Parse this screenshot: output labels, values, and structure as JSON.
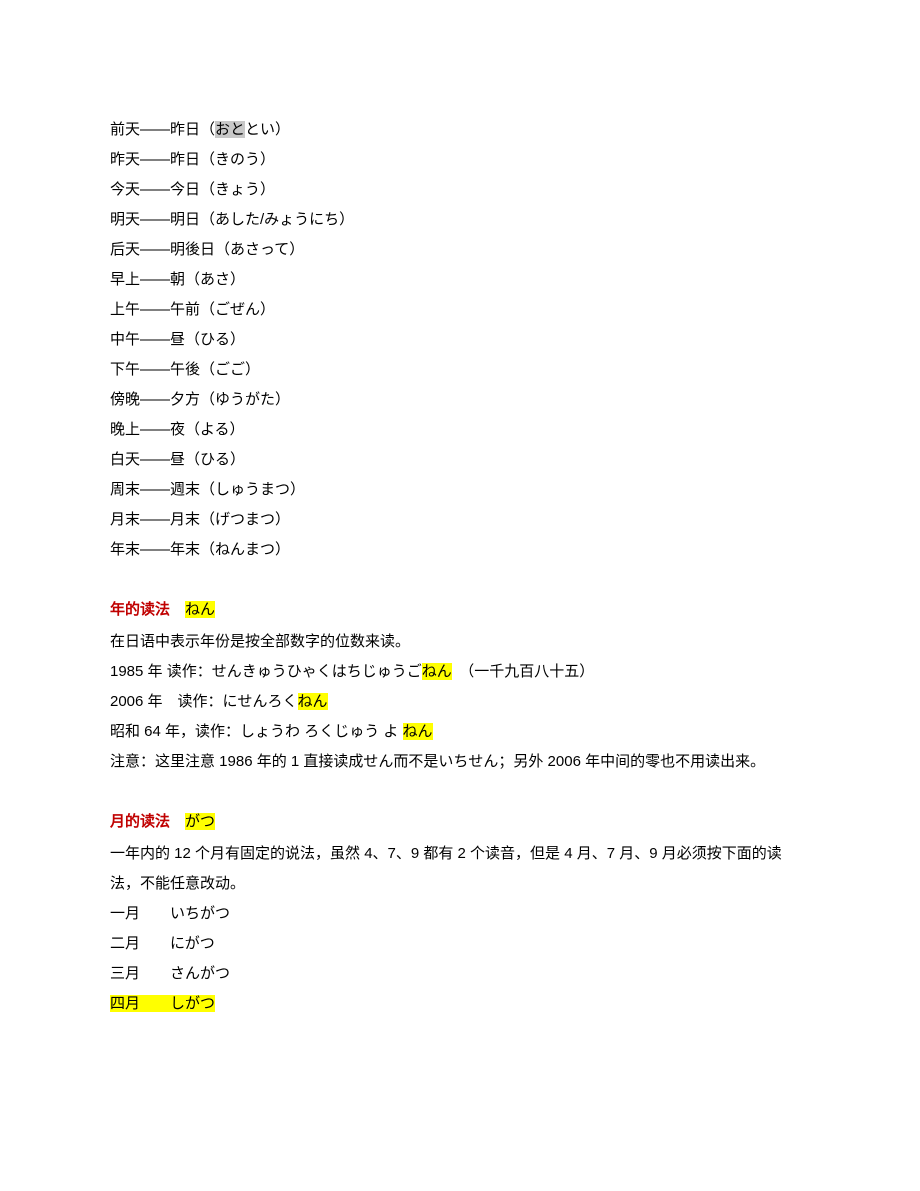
{
  "vocab": [
    {
      "pre": "前天——昨日（",
      "gray": "おと",
      "post": "とい）"
    },
    {
      "text": "昨天——昨日（きのう）"
    },
    {
      "text": "今天——今日（きょう）"
    },
    {
      "text": "明天——明日（あした/みょうにち）"
    },
    {
      "text": "后天——明後日（あさって）"
    },
    {
      "text": "早上——朝（あさ）"
    },
    {
      "text": "上午——午前（ごぜん）"
    },
    {
      "text": "中午——昼（ひる）"
    },
    {
      "text": "下午——午後（ごご）"
    },
    {
      "text": "傍晚——夕方（ゆうがた）"
    },
    {
      "text": "晚上——夜（よる）"
    },
    {
      "text": "白天——昼（ひる）"
    },
    {
      "text": "周末——週末（しゅうまつ）"
    },
    {
      "text": "月末——月末（げつまつ）"
    },
    {
      "text": "年末——年末（ねんまつ）"
    }
  ],
  "year": {
    "title": "年的读法",
    "tag": "ねん",
    "intro": "在日语中表示年份是按全部数字的位数来读。",
    "ex1_pre": "1985 年 读作：せんきゅうひゃくはちじゅうご",
    "ex1_hl": "ねん",
    "ex1_post": "　（一千九百八十五）",
    "ex2_pre": "2006 年　读作：にせんろく",
    "ex2_hl": "ねん",
    "ex3_pre": "昭和 64 年，读作：しょうわ ろくじゅう よ ",
    "ex3_hl": "ねん",
    "note": "注意：这里注意 1986 年的 1 直接读成せん而不是いちせん；另外 2006 年中间的零也不用读出来。"
  },
  "month": {
    "title": "月的读法",
    "tag": "がつ",
    "intro": "一年内的 12 个月有固定的说法，虽然 4、7、9 都有 2 个读音，但是 4 月、7 月、9 月必须按下面的读法，不能任意改动。",
    "m1": "一月　　いちがつ",
    "m2": "二月　　にがつ",
    "m3": "三月　　さんがつ",
    "m4": "四月　　しがつ"
  }
}
